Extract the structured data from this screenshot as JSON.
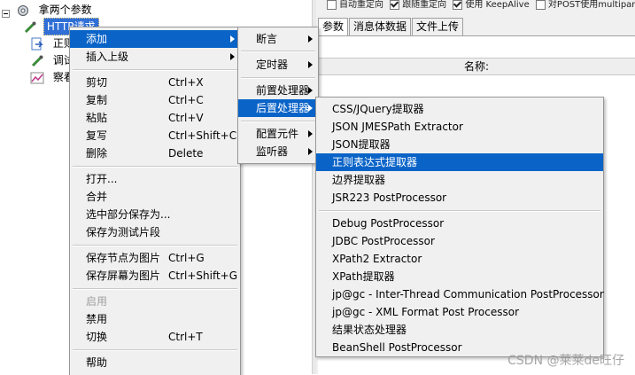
{
  "tree": {
    "root_label": "拿两个参数",
    "items": [
      {
        "label": "HTTP请求"
      },
      {
        "label": "正则"
      },
      {
        "label": "调试"
      },
      {
        "label": "察看"
      }
    ]
  },
  "top_options": {
    "opt1": "自动重定向",
    "opt2": "跟随重定向",
    "opt3": "使用 KeepAlive",
    "opt4": "对POST使用multipart"
  },
  "tabs": [
    {
      "label": "参数"
    },
    {
      "label": "消息体数据"
    },
    {
      "label": "文件上传"
    }
  ],
  "params_table": {
    "header": "名称:"
  },
  "context_menu": {
    "items": [
      {
        "label": "添加"
      },
      {
        "label": "插入上级"
      },
      {
        "label": "剪切",
        "shortcut": "Ctrl+X"
      },
      {
        "label": "复制",
        "shortcut": "Ctrl+C"
      },
      {
        "label": "粘贴",
        "shortcut": "Ctrl+V"
      },
      {
        "label": "复写",
        "shortcut": "Ctrl+Shift+C"
      },
      {
        "label": "删除",
        "shortcut": "Delete"
      },
      {
        "label": "打开..."
      },
      {
        "label": "合并"
      },
      {
        "label": "选中部分保存为..."
      },
      {
        "label": "保存为测试片段"
      },
      {
        "label": "保存节点为图片",
        "shortcut": "Ctrl+G"
      },
      {
        "label": "保存屏幕为图片",
        "shortcut": "Ctrl+Shift+G"
      },
      {
        "label": "启用"
      },
      {
        "label": "禁用"
      },
      {
        "label": "切换",
        "shortcut": "Ctrl+T"
      },
      {
        "label": "帮助"
      }
    ]
  },
  "add_submenu": {
    "items": [
      {
        "label": "断言"
      },
      {
        "label": "定时器"
      },
      {
        "label": "前置处理器"
      },
      {
        "label": "后置处理器"
      },
      {
        "label": "配置元件"
      },
      {
        "label": "监听器"
      }
    ]
  },
  "postprocessor_submenu": {
    "items": [
      {
        "label": "CSS/JQuery提取器"
      },
      {
        "label": "JSON JMESPath Extractor"
      },
      {
        "label": "JSON提取器"
      },
      {
        "label": "正则表达式提取器"
      },
      {
        "label": "边界提取器"
      },
      {
        "label": "JSR223 PostProcessor"
      },
      {
        "label": "Debug PostProcessor"
      },
      {
        "label": "JDBC PostProcessor"
      },
      {
        "label": "XPath2 Extractor"
      },
      {
        "label": "XPath提取器"
      },
      {
        "label": "jp@gc - Inter-Thread Communication PostProcessor"
      },
      {
        "label": "jp@gc - XML Format Post Processor"
      },
      {
        "label": "结果状态处理器"
      },
      {
        "label": "BeanShell PostProcessor"
      }
    ]
  },
  "watermark": "CSDN @莱莱de旺仔",
  "colors": {
    "highlight": "#0a64c8",
    "menu_bg": "#f0f0f0",
    "tree_selected": "#2f6fd6"
  }
}
